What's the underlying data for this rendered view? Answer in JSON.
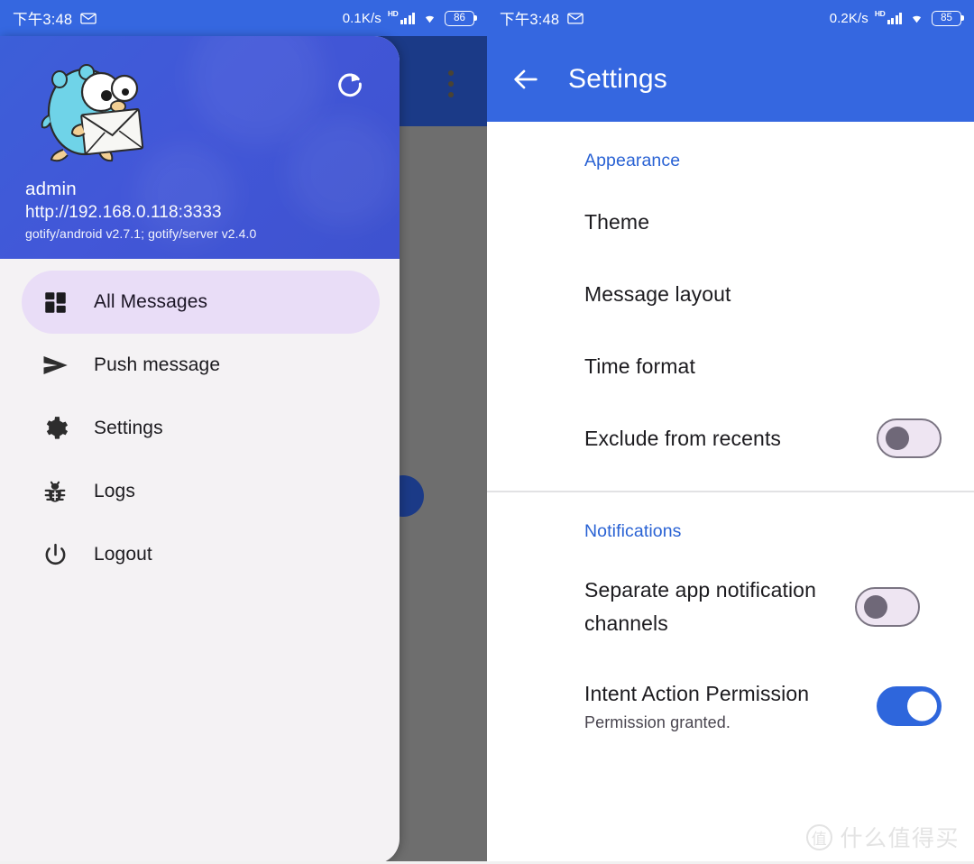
{
  "left_phone": {
    "statusbar": {
      "time": "下午3:48",
      "mail_icon": "envelope-icon",
      "net_speed": "0.1K/s",
      "hd_label": "HD",
      "signal_icon": "signal-bars-icon",
      "wifi_icon": "wifi-icon",
      "battery": "86"
    },
    "background_screen": {
      "overflow_menu": "overflow-menu-icon",
      "fab": "floating-action-button"
    },
    "drawer": {
      "avatar_icon": "gotify-gopher-avatar",
      "refresh_icon": "refresh-icon",
      "username": "admin",
      "server_url": "http://192.168.0.118:3333",
      "version": "gotify/android v2.7.1; gotify/server v2.4.0",
      "items": [
        {
          "label": "All Messages",
          "icon": "dashboard-grid-icon",
          "active": true
        },
        {
          "label": "Push message",
          "icon": "send-paper-plane-icon",
          "active": false
        },
        {
          "label": "Settings",
          "icon": "gear-icon",
          "active": false
        },
        {
          "label": "Logs",
          "icon": "bug-icon",
          "active": false
        },
        {
          "label": "Logout",
          "icon": "power-icon",
          "active": false
        }
      ]
    }
  },
  "right_phone": {
    "statusbar": {
      "time": "下午3:48",
      "mail_icon": "envelope-icon",
      "net_speed": "0.2K/s",
      "hd_label": "HD",
      "signal_icon": "signal-bars-icon",
      "wifi_icon": "wifi-icon",
      "battery": "85"
    },
    "appbar": {
      "back_icon": "back-arrow-icon",
      "title": "Settings"
    },
    "sections": [
      {
        "header": "Appearance",
        "items": [
          {
            "title": "Theme",
            "subtitle": "",
            "control": "none"
          },
          {
            "title": "Message layout",
            "subtitle": "",
            "control": "none"
          },
          {
            "title": "Time format",
            "subtitle": "",
            "control": "none"
          },
          {
            "title": "Exclude from recents",
            "subtitle": "",
            "control": "switch",
            "state": "off"
          }
        ]
      },
      {
        "header": "Notifications",
        "items": [
          {
            "title": "Separate app notification channels",
            "subtitle": "",
            "control": "switch",
            "state": "off"
          },
          {
            "title": "Intent Action Permission",
            "subtitle": "Permission granted.",
            "control": "switch",
            "state": "on"
          }
        ]
      }
    ]
  },
  "watermark": {
    "logo_char": "值",
    "text": "什么值得买"
  },
  "colors": {
    "status_blue": "#3567e0",
    "appbar_blue": "#3567e0",
    "drawer_header_blue": "#4257d8",
    "section_header_blue": "#2962d4",
    "active_pill": "#e9ddf7",
    "switch_on": "#2e66dc",
    "scrim_gray": "#6e6e6e",
    "bg_appbar_dark": "#1b3a87"
  }
}
